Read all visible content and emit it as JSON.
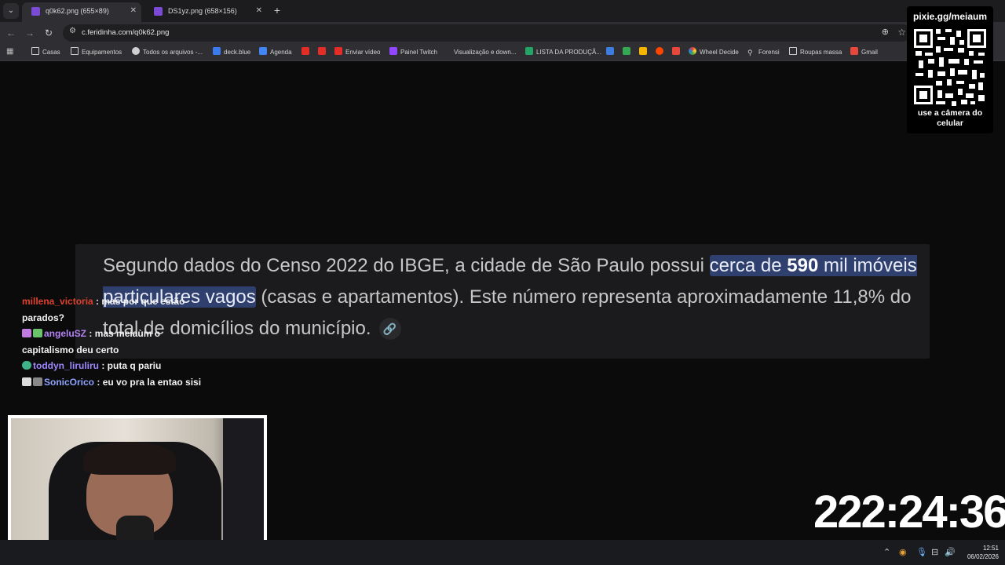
{
  "browser": {
    "tabs": [
      {
        "label": "q0k62.png (655×89)",
        "active": true
      },
      {
        "label": "DS1yz.png (658×156)",
        "active": false
      }
    ],
    "url": "c.feridinha.com/q0k62.png",
    "bookmarks": [
      {
        "label": "Casas",
        "icon": "folder-icon"
      },
      {
        "label": "Equipamentos",
        "icon": "folder-icon"
      },
      {
        "label": "Todos os arquivos -...",
        "icon": "globe-icon"
      },
      {
        "label": "deck.blue",
        "icon": "bluesky-icon"
      },
      {
        "label": "Agenda",
        "icon": "calendar-icon"
      },
      {
        "label": "",
        "icon": "youtube-icon"
      },
      {
        "label": "",
        "icon": "youtube-icon"
      },
      {
        "label": "Enviar vídeo",
        "icon": "youtube-icon"
      },
      {
        "label": "Painel Twitch",
        "icon": "twitch-icon"
      },
      {
        "label": "Visualização e down...",
        "icon": "blank-icon"
      },
      {
        "label": "LISTA DA PRODUÇÃ...",
        "icon": "sheets-icon"
      },
      {
        "label": "Wheel Decide",
        "icon": "wheel-icon"
      },
      {
        "label": "Forensi",
        "icon": "search-icon"
      },
      {
        "label": "Roupas massa",
        "icon": "folder-icon"
      },
      {
        "label": "Gmail",
        "icon": "gmail-icon"
      }
    ]
  },
  "content": {
    "text_before": "Segundo dados do Censo 2022 do IBGE, a cidade de São Paulo possui ",
    "highlight_1": "cerca de ",
    "highlight_bold": "590",
    "highlight_2": "mil imóveis particulares vagos",
    "text_after": " (casas e apartamentos). Este número representa aproximadamente 11,8% do total de domicílios do município."
  },
  "chat": {
    "messages": [
      {
        "user": "millena_victoria",
        "color": "#e0412f",
        "text": "mas por que estão parados?"
      },
      {
        "user": "angeluSZ",
        "color": "#b383f2",
        "text": "mas meiaùm o capitalismo deu certo"
      },
      {
        "user": "toddyn_liruliru",
        "color": "#9f87ff",
        "text": "puta q pariu"
      },
      {
        "user": "SonicOrico",
        "color": "#8fa3ff",
        "text": "eu vo pra la entao sisi"
      }
    ]
  },
  "stream": {
    "timer": "222:24:36",
    "qr_title": "pixie.gg/meiaum",
    "qr_caption": "use a câmera do celular"
  },
  "taskbar": {
    "time": "12:51",
    "date": "06/02/2026"
  },
  "colors": {
    "highlight_bg": "#2f3f6e",
    "card_bg": "#1b1b1d",
    "page_bg": "#0b0b0b"
  }
}
